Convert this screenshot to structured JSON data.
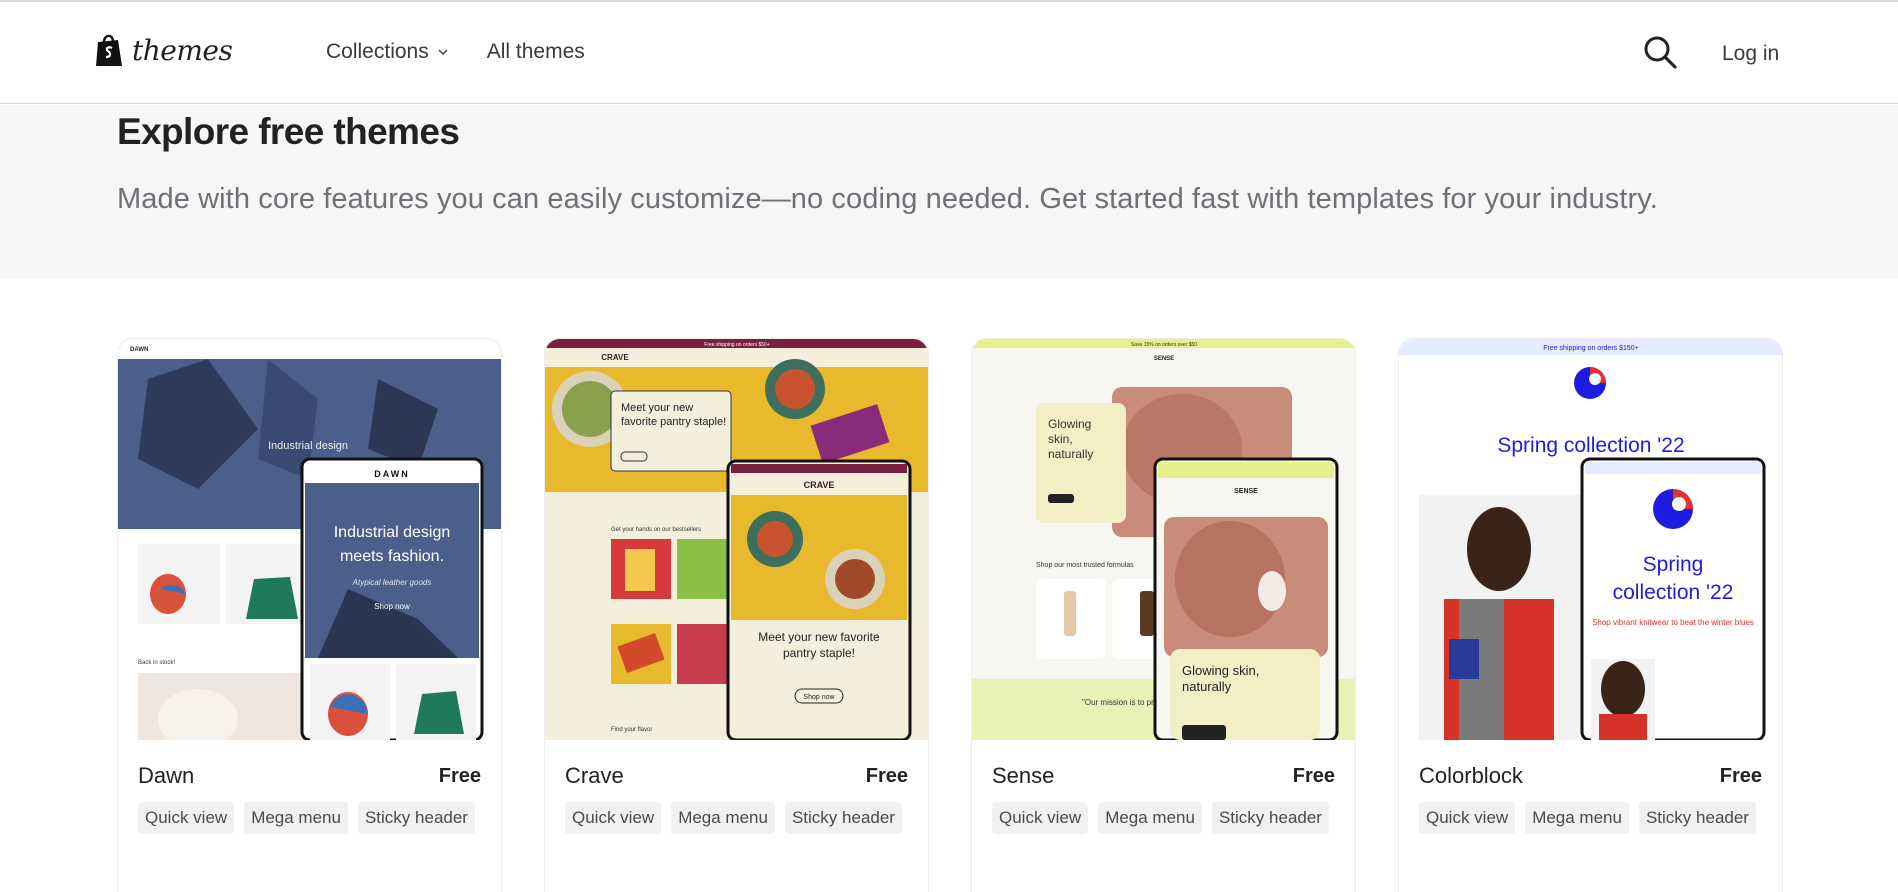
{
  "header": {
    "logo_text": "themes",
    "nav": [
      {
        "label": "Collections",
        "has_dropdown": true
      },
      {
        "label": "All themes",
        "has_dropdown": false
      }
    ],
    "login_label": "Log in"
  },
  "hero": {
    "title": "Explore free themes",
    "subtitle": "Made with core features you can easily customize—no coding needed. Get started fast with templates for your industry."
  },
  "themes": [
    {
      "name": "Dawn",
      "price": "Free",
      "tags": [
        "Quick view",
        "Mega menu",
        "Sticky header"
      ],
      "preview": {
        "brand": "DAWN",
        "headline": "Industrial design meets fashion.",
        "subline": "Atypical leather goods",
        "cta": "Shop now",
        "section": "Back in stock!"
      }
    },
    {
      "name": "Crave",
      "price": "Free",
      "tags": [
        "Quick view",
        "Mega menu",
        "Sticky header"
      ],
      "preview": {
        "brand": "CRAVE",
        "banner": "Free shipping on orders $50+",
        "headline": "Meet your new favorite pantry staple!",
        "section": "Get your hands on our bestsellers",
        "cta": "Shop now",
        "footer": "Find your flavor"
      }
    },
    {
      "name": "Sense",
      "price": "Free",
      "tags": [
        "Quick view",
        "Mega menu",
        "Sticky header"
      ],
      "preview": {
        "brand": "SENSE",
        "banner": "Save 15% on orders over $50",
        "headline": "Glowing skin, naturally",
        "section": "Shop our most trusted formulas",
        "mission": "\"Our mission is to provide"
      }
    },
    {
      "name": "Colorblock",
      "price": "Free",
      "tags": [
        "Quick view",
        "Mega menu",
        "Sticky header"
      ],
      "preview": {
        "banner": "Free shipping on orders $150+",
        "headline": "Spring collection '22",
        "headline_mobile_1": "Spring",
        "headline_mobile_2": "collection '22",
        "subline": "Shop vibrant knitwear to beat the winter blues"
      }
    }
  ],
  "colors": {
    "hero_bg": "#f6f6f6",
    "crave_accent": "#7a1f3d",
    "sense_accent": "#e4f08a",
    "colorblock_accent": "#1d1de0"
  }
}
